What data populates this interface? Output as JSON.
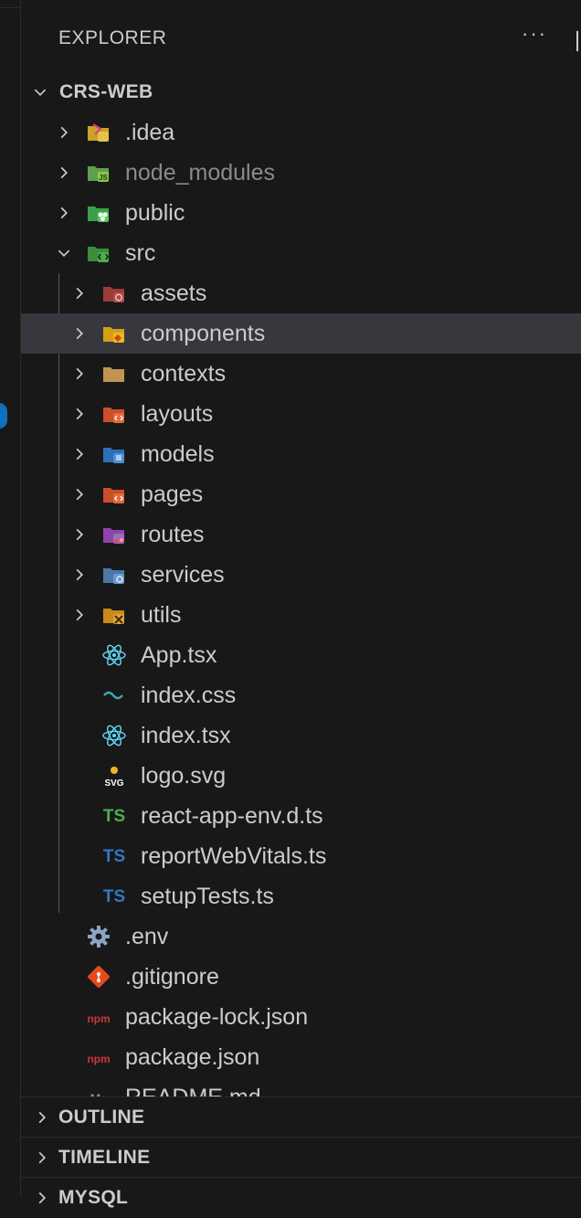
{
  "explorer": {
    "title": "EXPLORER",
    "more": "···"
  },
  "root": {
    "label": "CRS-WEB"
  },
  "items": [
    {
      "label": ".idea",
      "depth": 1,
      "chevron": "right",
      "icon": "idea-folder-icon",
      "dim": false
    },
    {
      "label": "node_modules",
      "depth": 1,
      "chevron": "right",
      "icon": "node-folder-icon",
      "dim": true
    },
    {
      "label": "public",
      "depth": 1,
      "chevron": "right",
      "icon": "public-folder-icon",
      "dim": false
    },
    {
      "label": "src",
      "depth": 1,
      "chevron": "down",
      "icon": "src-folder-icon",
      "dim": false
    },
    {
      "label": "assets",
      "depth": 2,
      "chevron": "right",
      "icon": "assets-folder-icon",
      "dim": false
    },
    {
      "label": "components",
      "depth": 2,
      "chevron": "right",
      "icon": "components-folder-icon",
      "dim": false,
      "selected": true
    },
    {
      "label": "contexts",
      "depth": 2,
      "chevron": "right",
      "icon": "folder-icon",
      "dim": false
    },
    {
      "label": "layouts",
      "depth": 2,
      "chevron": "right",
      "icon": "layouts-folder-icon",
      "dim": false
    },
    {
      "label": "models",
      "depth": 2,
      "chevron": "right",
      "icon": "models-folder-icon",
      "dim": false
    },
    {
      "label": "pages",
      "depth": 2,
      "chevron": "right",
      "icon": "pages-folder-icon",
      "dim": false
    },
    {
      "label": "routes",
      "depth": 2,
      "chevron": "right",
      "icon": "routes-folder-icon",
      "dim": false
    },
    {
      "label": "services",
      "depth": 2,
      "chevron": "right",
      "icon": "services-folder-icon",
      "dim": false
    },
    {
      "label": "utils",
      "depth": 2,
      "chevron": "right",
      "icon": "utils-folder-icon",
      "dim": false
    },
    {
      "label": "App.tsx",
      "depth": 2,
      "chevron": "none",
      "icon": "react-icon",
      "dim": false
    },
    {
      "label": "index.css",
      "depth": 2,
      "chevron": "none",
      "icon": "tailwind-icon",
      "dim": false
    },
    {
      "label": "index.tsx",
      "depth": 2,
      "chevron": "none",
      "icon": "react-icon",
      "dim": false
    },
    {
      "label": "logo.svg",
      "depth": 2,
      "chevron": "none",
      "icon": "svg-icon",
      "dim": false
    },
    {
      "label": "react-app-env.d.ts",
      "depth": 2,
      "chevron": "none",
      "icon": "ts-green-icon",
      "dim": false
    },
    {
      "label": "reportWebVitals.ts",
      "depth": 2,
      "chevron": "none",
      "icon": "ts-blue-icon",
      "dim": false
    },
    {
      "label": "setupTests.ts",
      "depth": 2,
      "chevron": "none",
      "icon": "ts-blue-icon",
      "dim": false
    },
    {
      "label": ".env",
      "depth": 1,
      "chevron": "none",
      "icon": "gear-icon",
      "dim": false
    },
    {
      "label": ".gitignore",
      "depth": 1,
      "chevron": "none",
      "icon": "git-icon",
      "dim": false
    },
    {
      "label": "package-lock.json",
      "depth": 1,
      "chevron": "none",
      "icon": "npm-icon",
      "dim": false
    },
    {
      "label": "package.json",
      "depth": 1,
      "chevron": "none",
      "icon": "npm-icon",
      "dim": false
    },
    {
      "label": "README.md",
      "depth": 1,
      "chevron": "none",
      "icon": "markdown-icon",
      "dim": false
    }
  ],
  "sections": [
    {
      "label": "OUTLINE"
    },
    {
      "label": "TIMELINE"
    },
    {
      "label": "MYSQL"
    }
  ],
  "badges": {
    "ts": "TS",
    "svg": "SVG",
    "npm": "npm",
    "md": "M↓"
  },
  "colors": {
    "background": "#181818",
    "selected": "#37373d",
    "text": "#cccccc",
    "dim_text": "#8b8b8b",
    "ts_green": "#4caf50",
    "ts_blue": "#3178c6",
    "react_blue": "#61dafb",
    "tailwind": "#44a8b3",
    "git": "#e64a19",
    "npm": "#cb3837"
  }
}
